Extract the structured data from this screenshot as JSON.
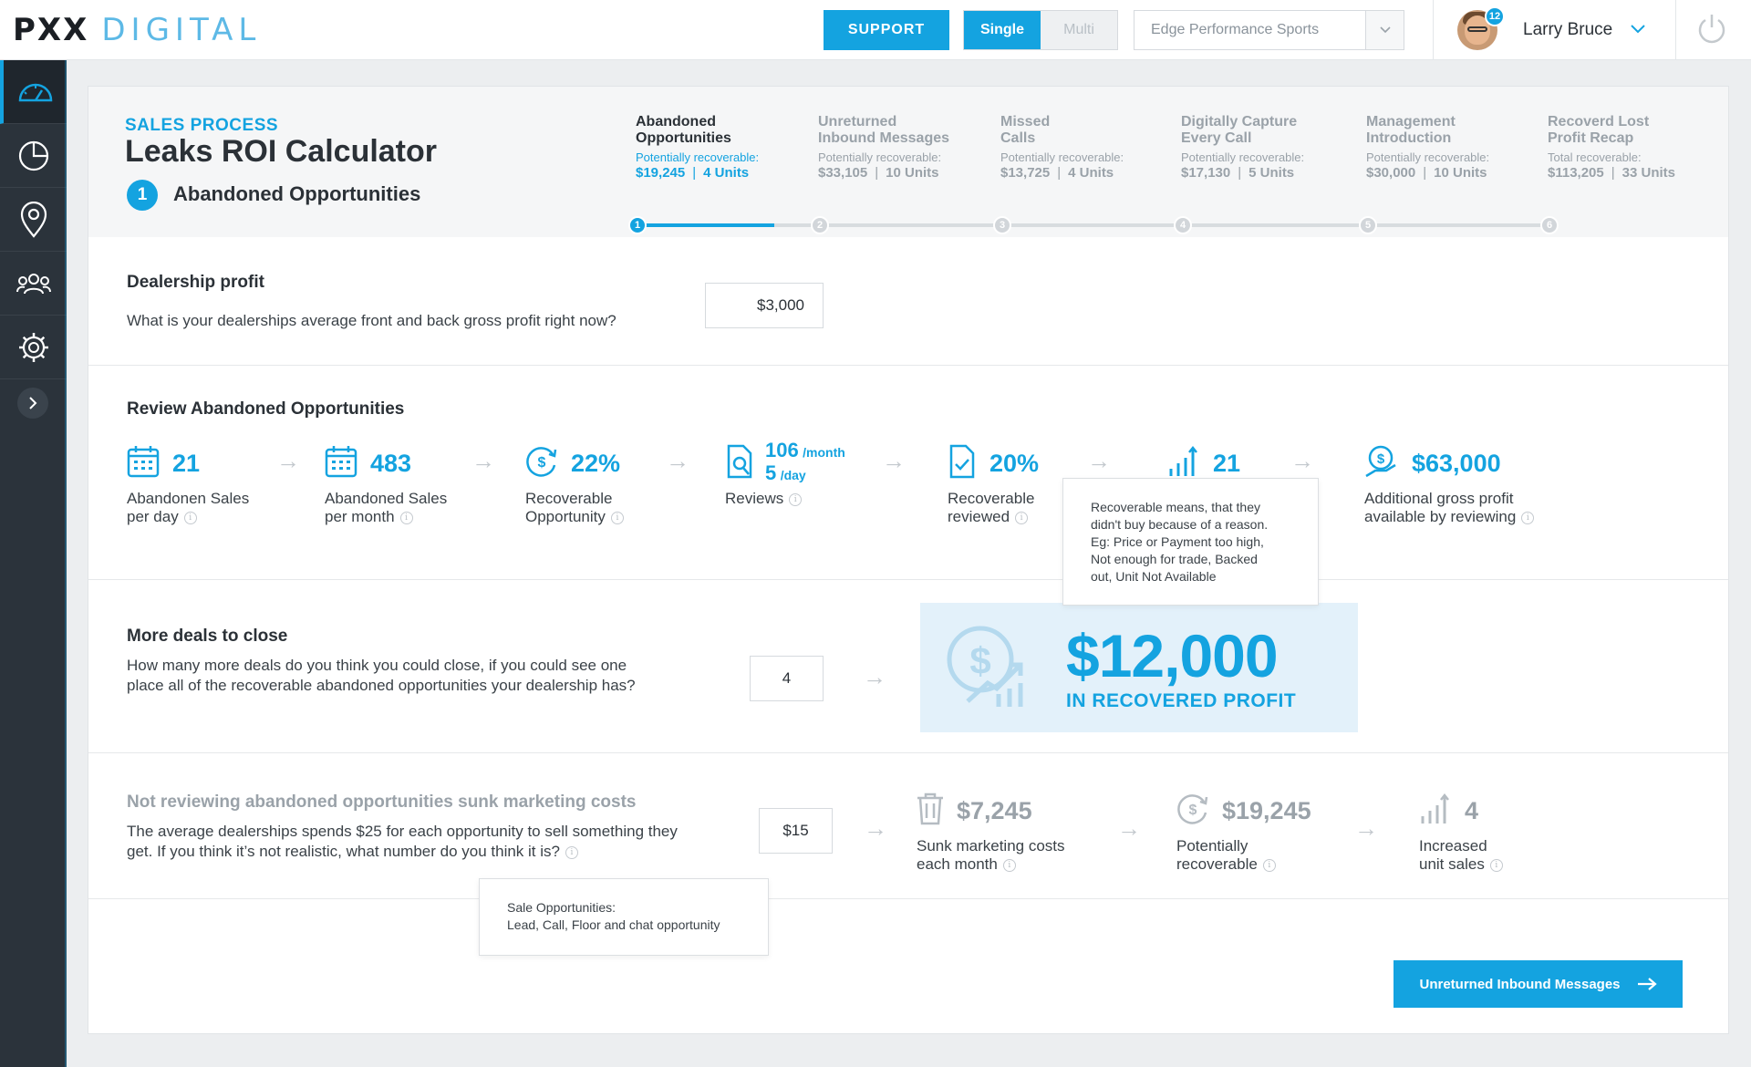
{
  "brand": {
    "mark": "PXX",
    "name": "DIGITAL"
  },
  "header": {
    "support_label": "SUPPORT",
    "mode_single": "Single",
    "mode_multi": "Multi",
    "dealer_value": "Edge Performance Sports",
    "notifications": "12",
    "user_name": "Larry Bruce"
  },
  "sidebar": {
    "items": [
      "dashboard-icon",
      "pie-chart-icon",
      "location-pin-icon",
      "people-icon",
      "settings-gear-icon"
    ],
    "expand": "chevron-right-icon"
  },
  "page": {
    "kicker": "SALES PROCESS",
    "title": "Leaks ROI Calculator",
    "step_number": "1",
    "step_name": "Abandoned Opportunities"
  },
  "steps": [
    {
      "name1": "Abandoned",
      "name2": "Opportunities",
      "label": "Potentially recoverable:",
      "amount": "$19,245",
      "units": "4 Units",
      "num": "1"
    },
    {
      "name1": "Unreturned",
      "name2": "Inbound Messages",
      "label": "Potentially recoverable:",
      "amount": "$33,105",
      "units": "10 Units",
      "num": "2"
    },
    {
      "name1": "Missed",
      "name2": "Calls",
      "label": "Potentially recoverable:",
      "amount": "$13,725",
      "units": "4 Units",
      "num": "3"
    },
    {
      "name1": "Digitally Capture",
      "name2": "Every Call",
      "label": "Potentially recoverable:",
      "amount": "$17,130",
      "units": "5 Units",
      "num": "4"
    },
    {
      "name1": "Management",
      "name2": "Introduction",
      "label": "Potentially recoverable:",
      "amount": "$30,000",
      "units": "10 Units",
      "num": "5"
    },
    {
      "name1": "Recoverd Lost",
      "name2": "Profit Recap",
      "label": "Total recoverable:",
      "amount": "$113,205",
      "units": "33 Units",
      "num": "6"
    }
  ],
  "dealership": {
    "title": "Dealership profit",
    "question": "What is your dealerships average front and back gross profit right now?",
    "value": "$3,000"
  },
  "review": {
    "title": "Review Abandoned Opportunities",
    "m1": {
      "value": "21",
      "l1": "Abandonen Sales",
      "l2": "per day"
    },
    "m2": {
      "value": "483",
      "l1": "Abandoned Sales",
      "l2": "per month"
    },
    "m3": {
      "value": "22%",
      "l1": "Recoverable",
      "l2": "Opportunity"
    },
    "m4": {
      "month": "106",
      "month_unit": "/month",
      "day": "5",
      "day_unit": "/day",
      "l1": "Reviews"
    },
    "m5": {
      "value": "20%",
      "l1": "Recoverable",
      "l2": "reviewed"
    },
    "m6": {
      "value": "21"
    },
    "m7": {
      "value": "$63,000",
      "l1": "Additional gross profit",
      "l2": "available by reviewing"
    },
    "tooltip": [
      "Recoverable means, that they",
      "didn't buy because of a reason.",
      "Eg: Price or Payment too high,",
      "Not enough for trade, Backed",
      "out, Unit Not Available"
    ]
  },
  "deals": {
    "title": "More deals to close",
    "text1": "How many more deals do you think you could close, if you could see one",
    "text2": "place all of the recoverable abandoned opportunities your dealership has?",
    "value": "4",
    "profit": "$12,000",
    "profit_label": "IN RECOVERED PROFIT"
  },
  "sunk": {
    "title": "Not reviewing abandoned opportunities sunk marketing costs",
    "text1": "The average dealerships spends $25 for each opportunity to sell something they",
    "text2": "get. If you think it’s not realistic, what number do you think it is?",
    "value": "$15",
    "m1": {
      "value": "$7,245",
      "l1": "Sunk marketing costs",
      "l2": "each month"
    },
    "m2": {
      "value": "$19,245",
      "l1": "Potentially",
      "l2": "recoverable"
    },
    "m3": {
      "value": "4",
      "l1": "Increased",
      "l2": "unit sales"
    },
    "tooltip": [
      "Sale Opportunities:",
      "Lead, Call, Floor and chat opportunity"
    ]
  },
  "next_label": "Unreturned Inbound Messages",
  "colors": {
    "accent": "#14a3e0",
    "sidebar": "#2b333b",
    "muted": "#9aa2a9"
  }
}
